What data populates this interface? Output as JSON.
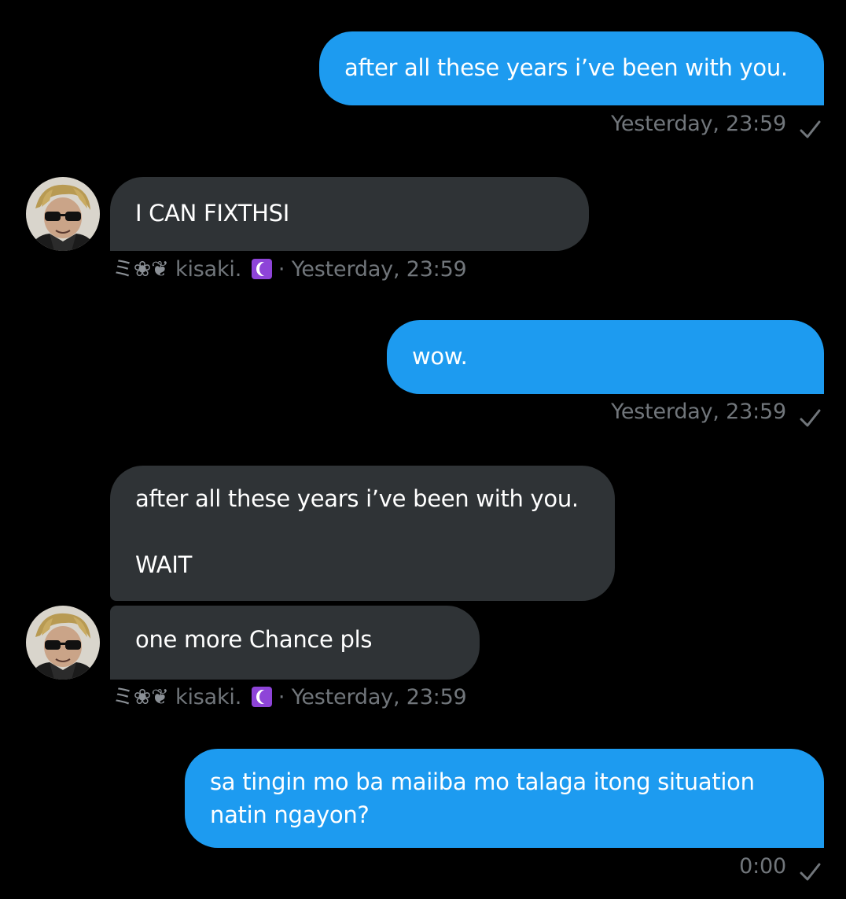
{
  "messages": [
    {
      "id": "m1",
      "direction": "sent",
      "text": "after all these years i’ve been with you.",
      "time": "Yesterday, 23:59"
    },
    {
      "id": "m2",
      "direction": "received",
      "text": "I CAN FIXTHSI",
      "sender": "kisaki.",
      "sender_prefix": "ミ❀❦",
      "time": "Yesterday, 23:59"
    },
    {
      "id": "m3",
      "direction": "sent",
      "text": "wow.",
      "time": "Yesterday, 23:59"
    },
    {
      "id": "m4",
      "direction": "received",
      "text": "after all these years i’ve been with you.\n\nWAIT"
    },
    {
      "id": "m5",
      "direction": "received",
      "text": "one more Chance pls",
      "sender": "kisaki.",
      "sender_prefix": "ミ❀❦",
      "time": "Yesterday, 23:59"
    },
    {
      "id": "m6",
      "direction": "sent",
      "text": "sa tingin mo ba maiiba mo talaga itong situation natin ngayon?",
      "time": "0:00"
    }
  ],
  "meta": {
    "separator": "·"
  },
  "colors": {
    "background": "#000000",
    "sent_bubble": "#1d9bf0",
    "received_bubble": "#2f3336",
    "meta_text": "#71767b",
    "badge_purple": "#8e44d8"
  },
  "icons": {
    "read_receipt": "check-icon",
    "badge": "crescent-moon-emoji",
    "avatar": "user-avatar"
  }
}
